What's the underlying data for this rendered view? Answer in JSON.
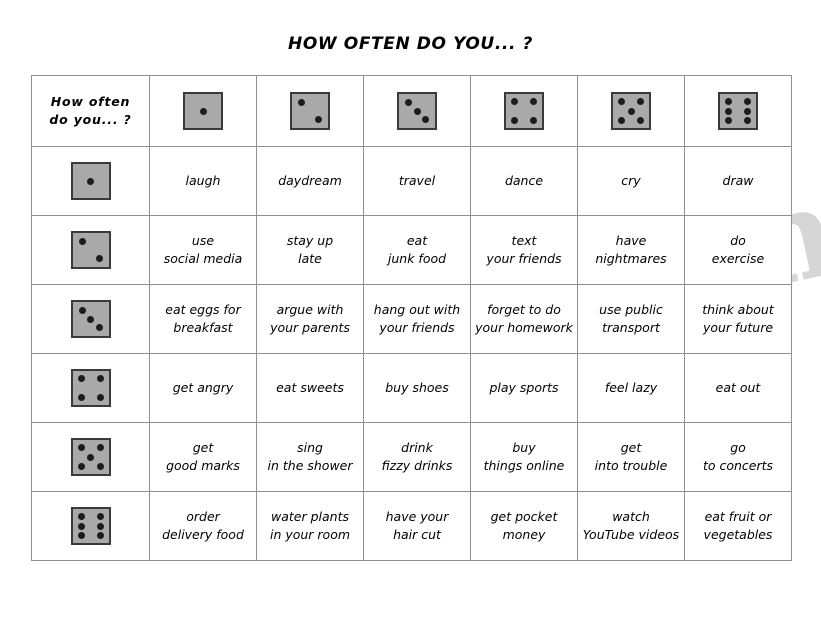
{
  "title": "HOW OFTEN DO YOU... ?",
  "watermark": "ables.com",
  "table": {
    "corner_label": "How often\ndo you... ?",
    "column_dice": [
      1,
      2,
      3,
      4,
      5,
      6
    ],
    "row_dice": [
      1,
      2,
      3,
      4,
      5,
      6
    ],
    "dice_colors": {
      "face": "#a9a9a9",
      "border": "#3a3a3a",
      "pip": "#1c1c1c"
    },
    "grid_line_color": "#909090",
    "rows": [
      {
        "die": 1,
        "cells": [
          "laugh",
          "daydream",
          "travel",
          "dance",
          "cry",
          "draw"
        ]
      },
      {
        "die": 2,
        "cells": [
          "use\nsocial media",
          "stay up\nlate",
          "eat\njunk food",
          "text\nyour friends",
          "have\nnightmares",
          "do\nexercise"
        ]
      },
      {
        "die": 3,
        "cells": [
          "eat eggs for\nbreakfast",
          "argue with\nyour parents",
          "hang out with\nyour friends",
          "forget to do\nyour homework",
          "use public\ntransport",
          "think about\nyour future"
        ]
      },
      {
        "die": 4,
        "cells": [
          "get angry",
          "eat sweets",
          "buy shoes",
          "play sports",
          "feel lazy",
          "eat out"
        ]
      },
      {
        "die": 5,
        "cells": [
          "get\ngood marks",
          "sing\nin the shower",
          "drink\nfizzy drinks",
          "buy\nthings online",
          "get\ninto trouble",
          "go\nto concerts"
        ]
      },
      {
        "die": 6,
        "cells": [
          "order\ndelivery food",
          "water plants\nin your room",
          "have your\nhair cut",
          "get pocket\nmoney",
          "watch\nYouTube videos",
          "eat fruit or\nvegetables"
        ]
      }
    ]
  }
}
